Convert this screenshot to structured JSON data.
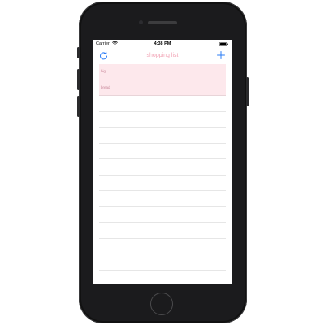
{
  "status_bar": {
    "carrier": "Carrier",
    "time": "4:38 PM"
  },
  "nav": {
    "title": "shopping list",
    "refresh_icon": "refresh-icon",
    "add_icon": "plus-icon",
    "tint_color": "#2b7cf6",
    "title_color": "#f2a3b5"
  },
  "list": {
    "items": [
      {
        "label": "big"
      },
      {
        "label": "bread"
      }
    ],
    "item_background": "#fde8ec"
  },
  "device": {
    "body_color": "#1b1b1d"
  }
}
